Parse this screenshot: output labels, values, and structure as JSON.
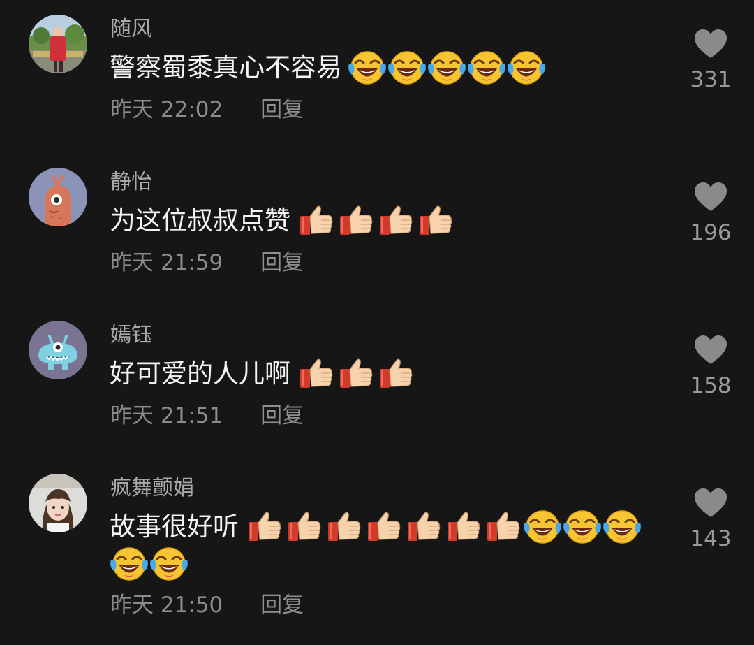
{
  "comments": [
    {
      "username": "随风",
      "text": "警察蜀黍真心不容易",
      "emojis": [
        "laughing-crying-emoji",
        "laughing-crying-emoji",
        "laughing-crying-emoji",
        "laughing-crying-emoji",
        "laughing-crying-emoji"
      ],
      "time": "昨天 22:02",
      "reply_label": "回复",
      "likes": "331",
      "avatar": "photo-avatar"
    },
    {
      "username": "静怡",
      "text": "为这位叔叔点赞",
      "emojis": [
        "thumbs-up-emoji",
        "thumbs-up-emoji",
        "thumbs-up-emoji",
        "thumbs-up-emoji"
      ],
      "time": "昨天 21:59",
      "reply_label": "回复",
      "likes": "196",
      "avatar": "cartoon-shrimp-avatar"
    },
    {
      "username": "嫣钰",
      "text": "好可爱的人儿啊",
      "emojis": [
        "thumbs-up-emoji",
        "thumbs-up-emoji",
        "thumbs-up-emoji"
      ],
      "time": "昨天 21:51",
      "reply_label": "回复",
      "likes": "158",
      "avatar": "cartoon-monster-avatar"
    },
    {
      "username": "疯舞颤娟",
      "text": "故事很好听",
      "emojis": [
        "thumbs-up-emoji",
        "thumbs-up-emoji",
        "thumbs-up-emoji",
        "thumbs-up-emoji",
        "thumbs-up-emoji",
        "thumbs-up-emoji",
        "thumbs-up-emoji",
        "laughing-crying-emoji",
        "laughing-crying-emoji",
        "laughing-crying-emoji"
      ],
      "emojis_line2": [
        "laughing-crying-emoji",
        "laughing-crying-emoji"
      ],
      "time": "昨天 21:50",
      "reply_label": "回复",
      "likes": "143",
      "avatar": "photo-avatar-girl"
    }
  ],
  "colors": {
    "background": "#161616",
    "username": "#a9a9ab",
    "text": "#f4f4f4",
    "meta": "#8c8c8e",
    "heart": "#8a8a8c"
  },
  "icons": {
    "like": "heart-icon"
  }
}
